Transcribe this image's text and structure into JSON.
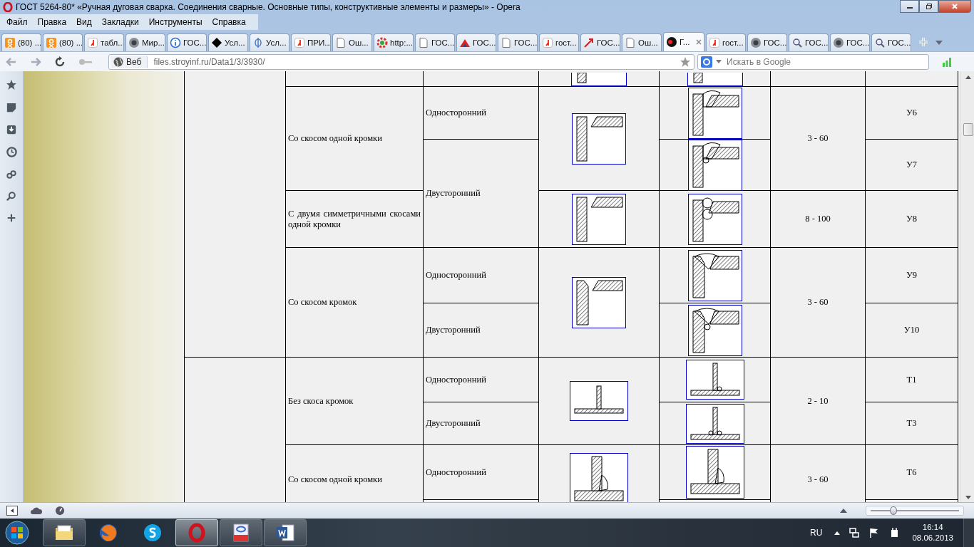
{
  "window": {
    "title": "ГОСТ 5264-80* «Ручная дуговая сварка. Соединения сварные. Основные типы, конструктивные элементы и размеры» - Opera"
  },
  "menu": [
    "Файл",
    "Правка",
    "Вид",
    "Закладки",
    "Инструменты",
    "Справка"
  ],
  "tabs": [
    {
      "label": "(80) ...",
      "selected": false
    },
    {
      "label": "(80) ...",
      "selected": false
    },
    {
      "label": "табл...",
      "selected": false
    },
    {
      "label": "Мир...",
      "selected": false
    },
    {
      "label": "ГОС...",
      "selected": false
    },
    {
      "label": "Усл...",
      "selected": false
    },
    {
      "label": "Усл...",
      "selected": false
    },
    {
      "label": "ПРИ...",
      "selected": false
    },
    {
      "label": "Ош...",
      "selected": false
    },
    {
      "label": "http:...",
      "selected": false
    },
    {
      "label": "ГОС...",
      "selected": false
    },
    {
      "label": "ГОС...",
      "selected": false
    },
    {
      "label": "ГОС...",
      "selected": false
    },
    {
      "label": "гост...",
      "selected": false
    },
    {
      "label": "ГОС...",
      "selected": false
    },
    {
      "label": "Ош...",
      "selected": false
    },
    {
      "label": "Г...",
      "selected": true
    },
    {
      "label": "гост...",
      "selected": false
    },
    {
      "label": "ГОС...",
      "selected": false
    },
    {
      "label": "ГОС...",
      "selected": false
    },
    {
      "label": "ГОС...",
      "selected": false
    },
    {
      "label": "ГОС...",
      "selected": false
    }
  ],
  "address_bar": {
    "site_button": "Веб",
    "url": "files.stroyinf.ru/Data1/3/3930/"
  },
  "search": {
    "placeholder": "Искать в Google"
  },
  "table": {
    "rows": [
      {
        "edge": "Со скосом одной кромки",
        "side": "Односторонний",
        "thickness": "3 - 60",
        "code": "У6"
      },
      {
        "side": "Двусторонний",
        "code": "У7"
      },
      {
        "edge": "С двумя симметричными скосами одной кромки",
        "thickness": "8 - 100",
        "code": "У8"
      },
      {
        "edge": "Со скосом кромок",
        "side": "Односторонний",
        "thickness": "3 - 60",
        "code": "У9"
      },
      {
        "side": "Двусторонний",
        "code": "У10"
      },
      {
        "group_start": true,
        "edge": "Без скоса кромок",
        "side": "Односторонний",
        "thickness": "2 - 10",
        "code": "Т1"
      },
      {
        "side": "Двусторонний",
        "code": "Т3"
      },
      {
        "edge": "Со скосом одной кромки",
        "side": "Односторонний",
        "thickness": "3 - 60",
        "code": "Т6"
      }
    ]
  },
  "status_bar": {
    "zoom": {
      "level": 0.28
    }
  },
  "taskbar": {
    "apps": [
      {
        "running": true,
        "selected": false
      },
      {
        "running": false,
        "selected": false
      },
      {
        "running": false,
        "selected": false
      },
      {
        "running": true,
        "selected": true
      },
      {
        "running": true,
        "selected": false
      },
      {
        "running": true,
        "selected": false
      }
    ],
    "language": "RU",
    "time": "16:14",
    "date": "08.06.2013"
  }
}
